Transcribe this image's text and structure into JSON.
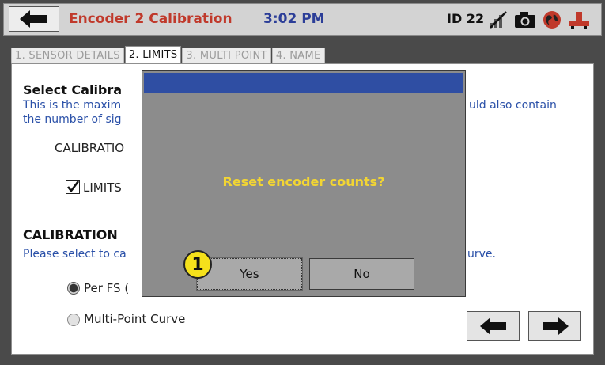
{
  "header": {
    "title": "Encoder 2 Calibration",
    "time": "3:02 PM",
    "device_id": "ID 22"
  },
  "icons": {
    "back": "back-arrow-icon",
    "signal": "no-signal-icon",
    "camera": "camera-icon",
    "globe": "globe-icon",
    "usb": "usb-icon"
  },
  "tabs": [
    {
      "label": "1. SENSOR DETAILS",
      "active": false
    },
    {
      "label": "2. LIMITS",
      "active": true
    },
    {
      "label": "3. MULTI POINT",
      "active": false
    },
    {
      "label": "4. NAME",
      "active": false
    }
  ],
  "section1": {
    "heading": "Select Calibra",
    "desc_line1_left": "This is the maxim",
    "desc_line1_right": "uld also contain",
    "desc_line2": "the number of sig",
    "field_label": "CALIBRATIO",
    "limits_checkbox_label": "LIMITS",
    "limits_checked": true
  },
  "section2": {
    "heading": "CALIBRATION",
    "desc_left": "Please select to ca",
    "desc_right": "urve.",
    "option1": "Per FS (",
    "option2": "Multi-Point Curve",
    "selected": "option1"
  },
  "dialog": {
    "message": "Reset encoder counts?",
    "yes_label": "Yes",
    "no_label": "No"
  },
  "badge": "1",
  "colors": {
    "title_red": "#c0392b",
    "time_blue": "#2c3e98",
    "dialog_titlebar": "#2f4ea3",
    "dialog_message": "#f2d533",
    "badge_yellow": "#f5e11b"
  }
}
